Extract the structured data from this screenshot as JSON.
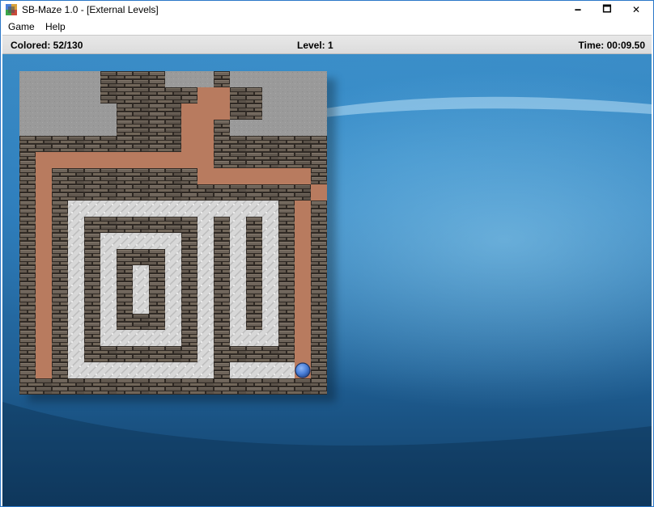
{
  "window": {
    "title": "SB-Maze 1.0 - [External Levels]",
    "controls": {
      "minimize": "🗕",
      "maximize": "🗖",
      "close": "✕"
    }
  },
  "menu": {
    "items": [
      "Game",
      "Help"
    ]
  },
  "status": {
    "colored": "Colored: 52/130",
    "level": "Level: 1",
    "time": "Time: 00:09.50"
  },
  "maze": {
    "cols": 19,
    "rows": 20,
    "legend": {
      "G": "empty-outside",
      "#": "wall",
      "P": "painted-floor",
      "W": "unpainted-floor"
    },
    "grid": [
      "GGGGG####GGG#GGGGGG",
      "GGGGG######PP##GGGG",
      "GGGGGG####PPP##GGGG",
      "GGGGGG####PP#GGGGGG",
      "##########PP#######",
      "#PPPPPPPPPPP#######",
      "#P#########PPPPPPP#",
      "#P################P#",
      "#P#WWWWWWWWWWWWW#P#",
      "#P#W#######W#W#W#P#",
      "#P#W#WWWWW#W#W#W#P#",
      "#P#W#W###W#W#W#W#P#",
      "#P#W#W#W#W#W#W#W#P#",
      "#P#W#W#W#W#W#W#W#P#",
      "#P#W#W#W#W#W#W#W#P#",
      "#P#W#W###W#W#W#W#P#",
      "#P#W#WWWWW#W#WWW#P#",
      "#P#W#######W#####P#",
      "#P#WWWWWWWWW#WWWWP#",
      "###################"
    ],
    "player": {
      "row": 18,
      "col": 17
    },
    "colors": {
      "painted": "#b87b5f",
      "floor": "#d9d9d9",
      "outside": "#9a9a9a",
      "wall_mortar": "#2f2924",
      "ball": "#4a7fd8"
    }
  }
}
